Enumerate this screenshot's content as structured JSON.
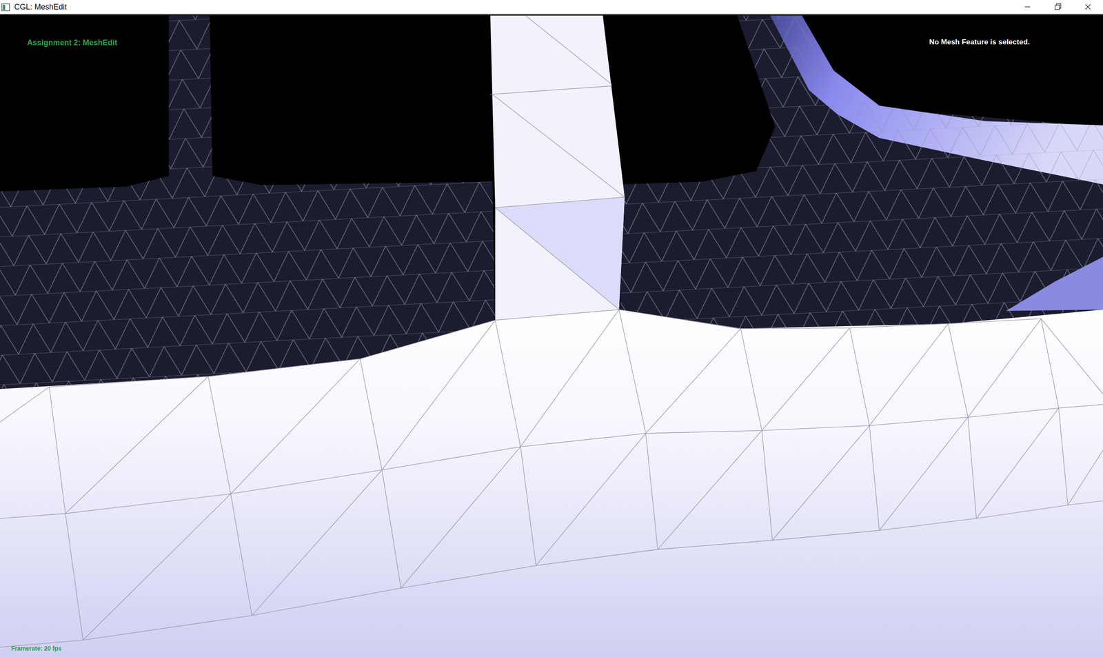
{
  "window": {
    "title": "CGL: MeshEdit"
  },
  "overlay": {
    "heading": "Assignment 2: MeshEdit",
    "selection_status": "No Mesh Feature is selected.",
    "framerate": "Framerate: 20 fps"
  }
}
